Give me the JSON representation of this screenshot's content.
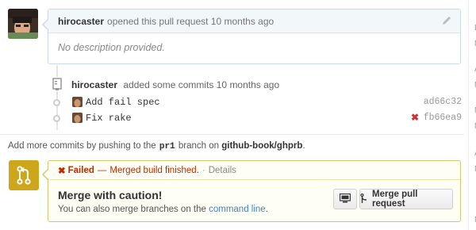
{
  "comment": {
    "author": "hirocaster",
    "action": "opened this pull request 10 months ago",
    "body": "No description provided."
  },
  "commit_event": {
    "author": "hirocaster",
    "action": "added some commits 10 months ago"
  },
  "commits": [
    {
      "message": "Add fail spec",
      "sha": "ad66c32",
      "status": ""
    },
    {
      "message": "Fix rake",
      "sha": "fb66ea9",
      "status": "✖"
    }
  ],
  "push_hint": {
    "prefix": "Add more commits by pushing to the",
    "branch": "pr1",
    "middle": "branch on",
    "repo": "github-book/ghprb",
    "suffix": "."
  },
  "merge": {
    "status_icon": "✖",
    "status_label": "Failed",
    "status_dash": "—",
    "status_detail": "Merged build finished.",
    "separator": "·",
    "details_link": "Details",
    "title": "Merge with caution!",
    "subtitle_prefix": "You can also merge branches on the",
    "subtitle_link": "command line",
    "subtitle_suffix": ".",
    "merge_button": "Merge pull request"
  },
  "right_edge_letters": [
    "L",
    "N",
    "A",
    "N",
    "M",
    "N",
    "A",
    "N",
    "N"
  ],
  "colors": {
    "merge_icon_bg": "#cea61b",
    "fail_red": "#bd2c00",
    "link_blue": "#4183c4",
    "header_bg": "#f2f8fa"
  }
}
